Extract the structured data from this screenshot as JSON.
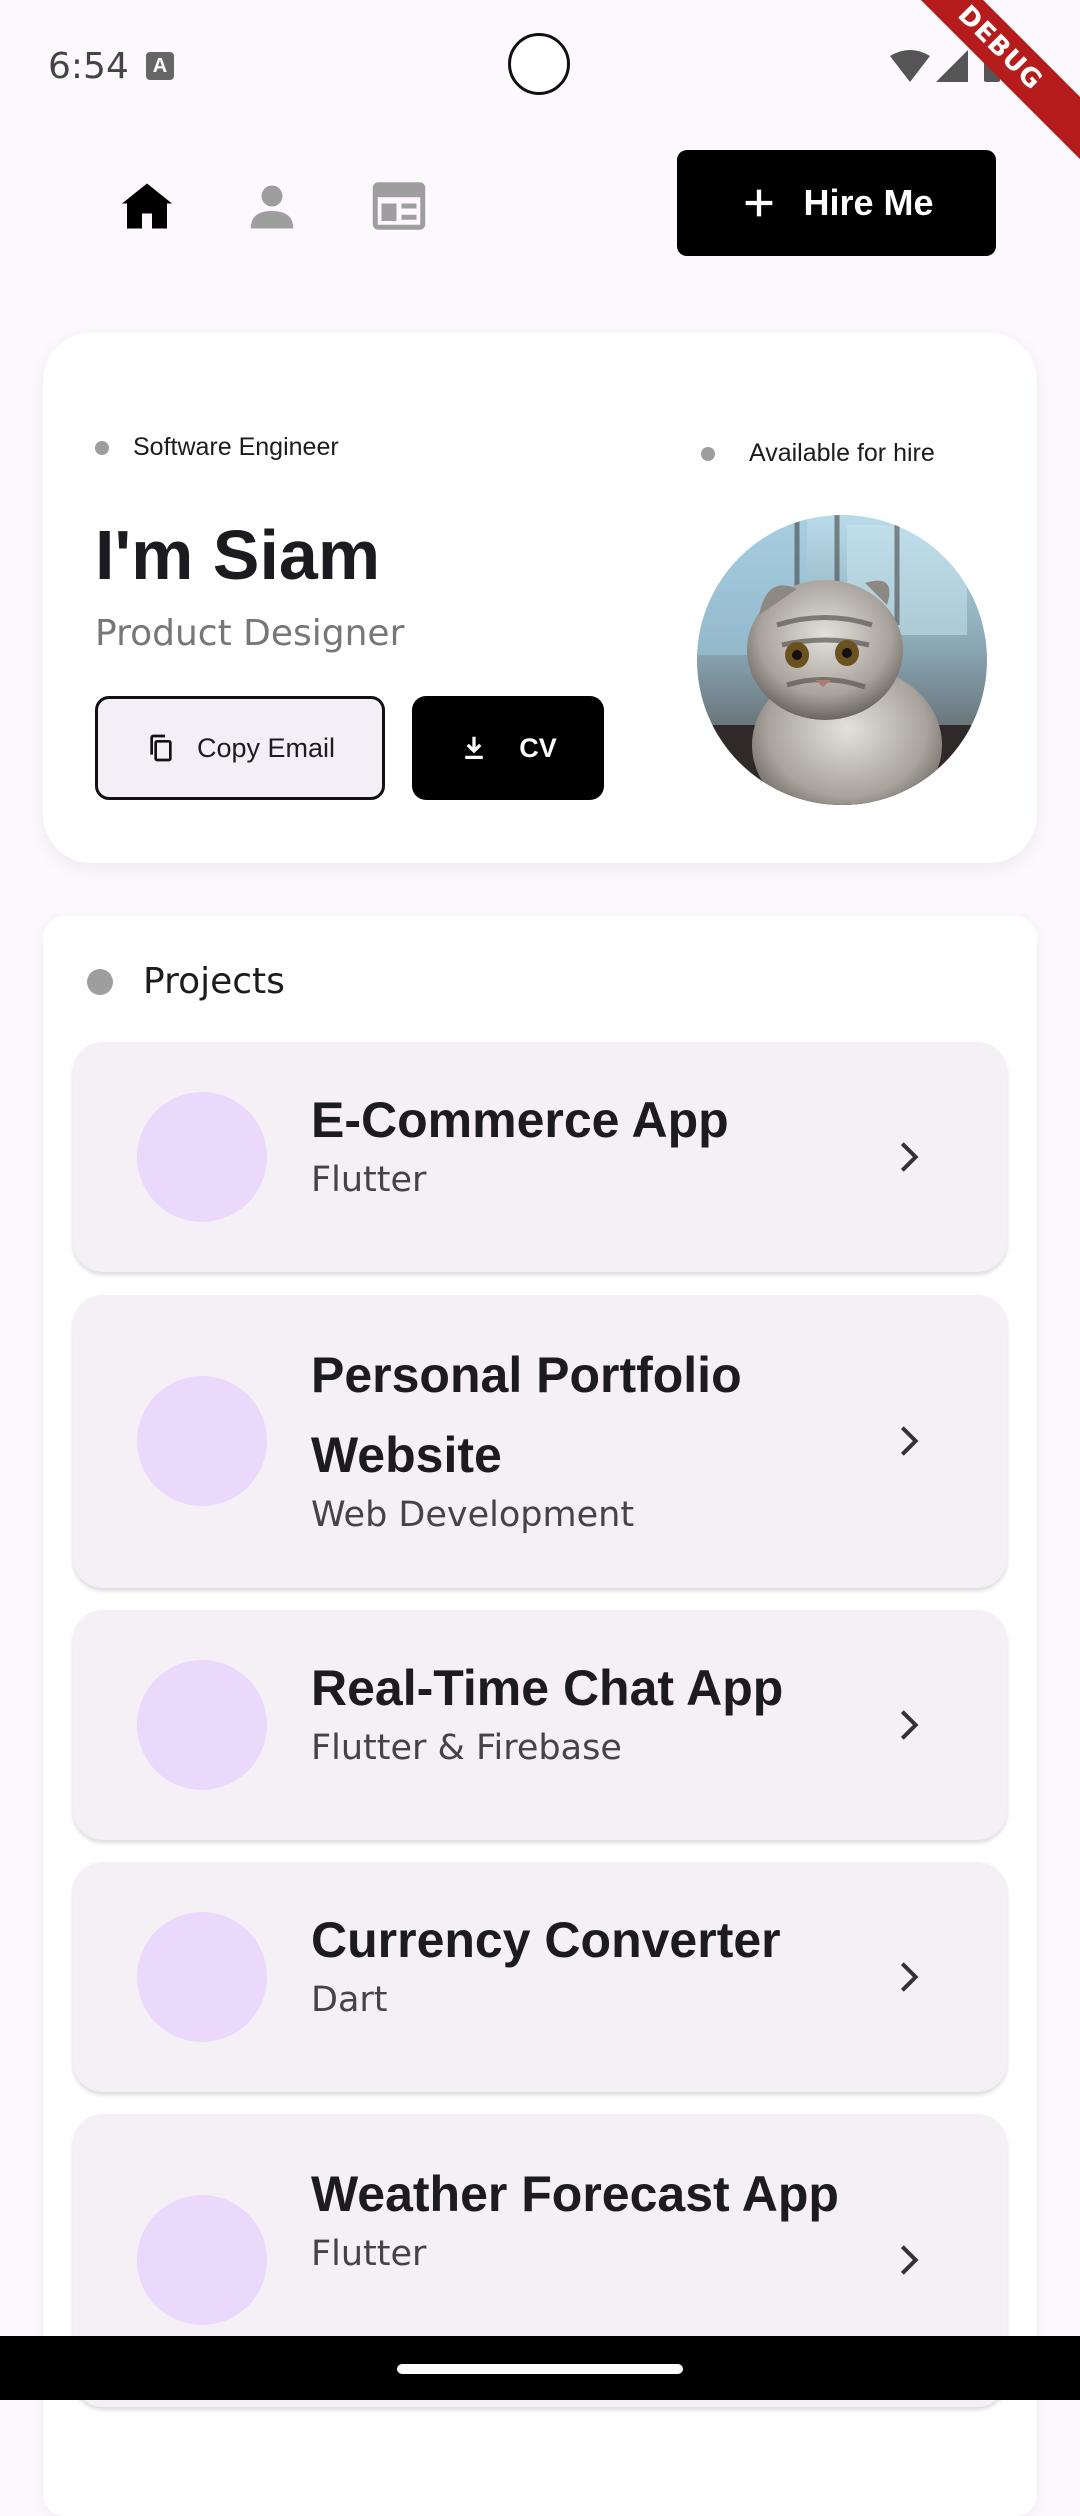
{
  "status": {
    "time": "6:54",
    "debug_label": "DEBUG"
  },
  "nav": {
    "hire_label": "Hire Me"
  },
  "hero": {
    "role": "Software Engineer",
    "availability": "Available for hire",
    "name": "I'm Siam",
    "subtitle": "Product Designer",
    "copy_email_label": "Copy Email",
    "cv_label": "CV"
  },
  "projects": {
    "heading": "Projects",
    "items": [
      {
        "title": "E-Commerce App",
        "subtitle": "Flutter"
      },
      {
        "title": "Personal Portfolio Website",
        "subtitle": "Web Development"
      },
      {
        "title": "Real-Time Chat App",
        "subtitle": "Flutter & Firebase"
      },
      {
        "title": "Currency Converter",
        "subtitle": "Dart"
      },
      {
        "title": "Weather Forecast App",
        "subtitle": "Flutter"
      }
    ]
  },
  "colors": {
    "accent": "#000000",
    "card_bg": "#f5eff6",
    "thumb": "#ead9fb",
    "page_bg": "#fdf8fd"
  }
}
